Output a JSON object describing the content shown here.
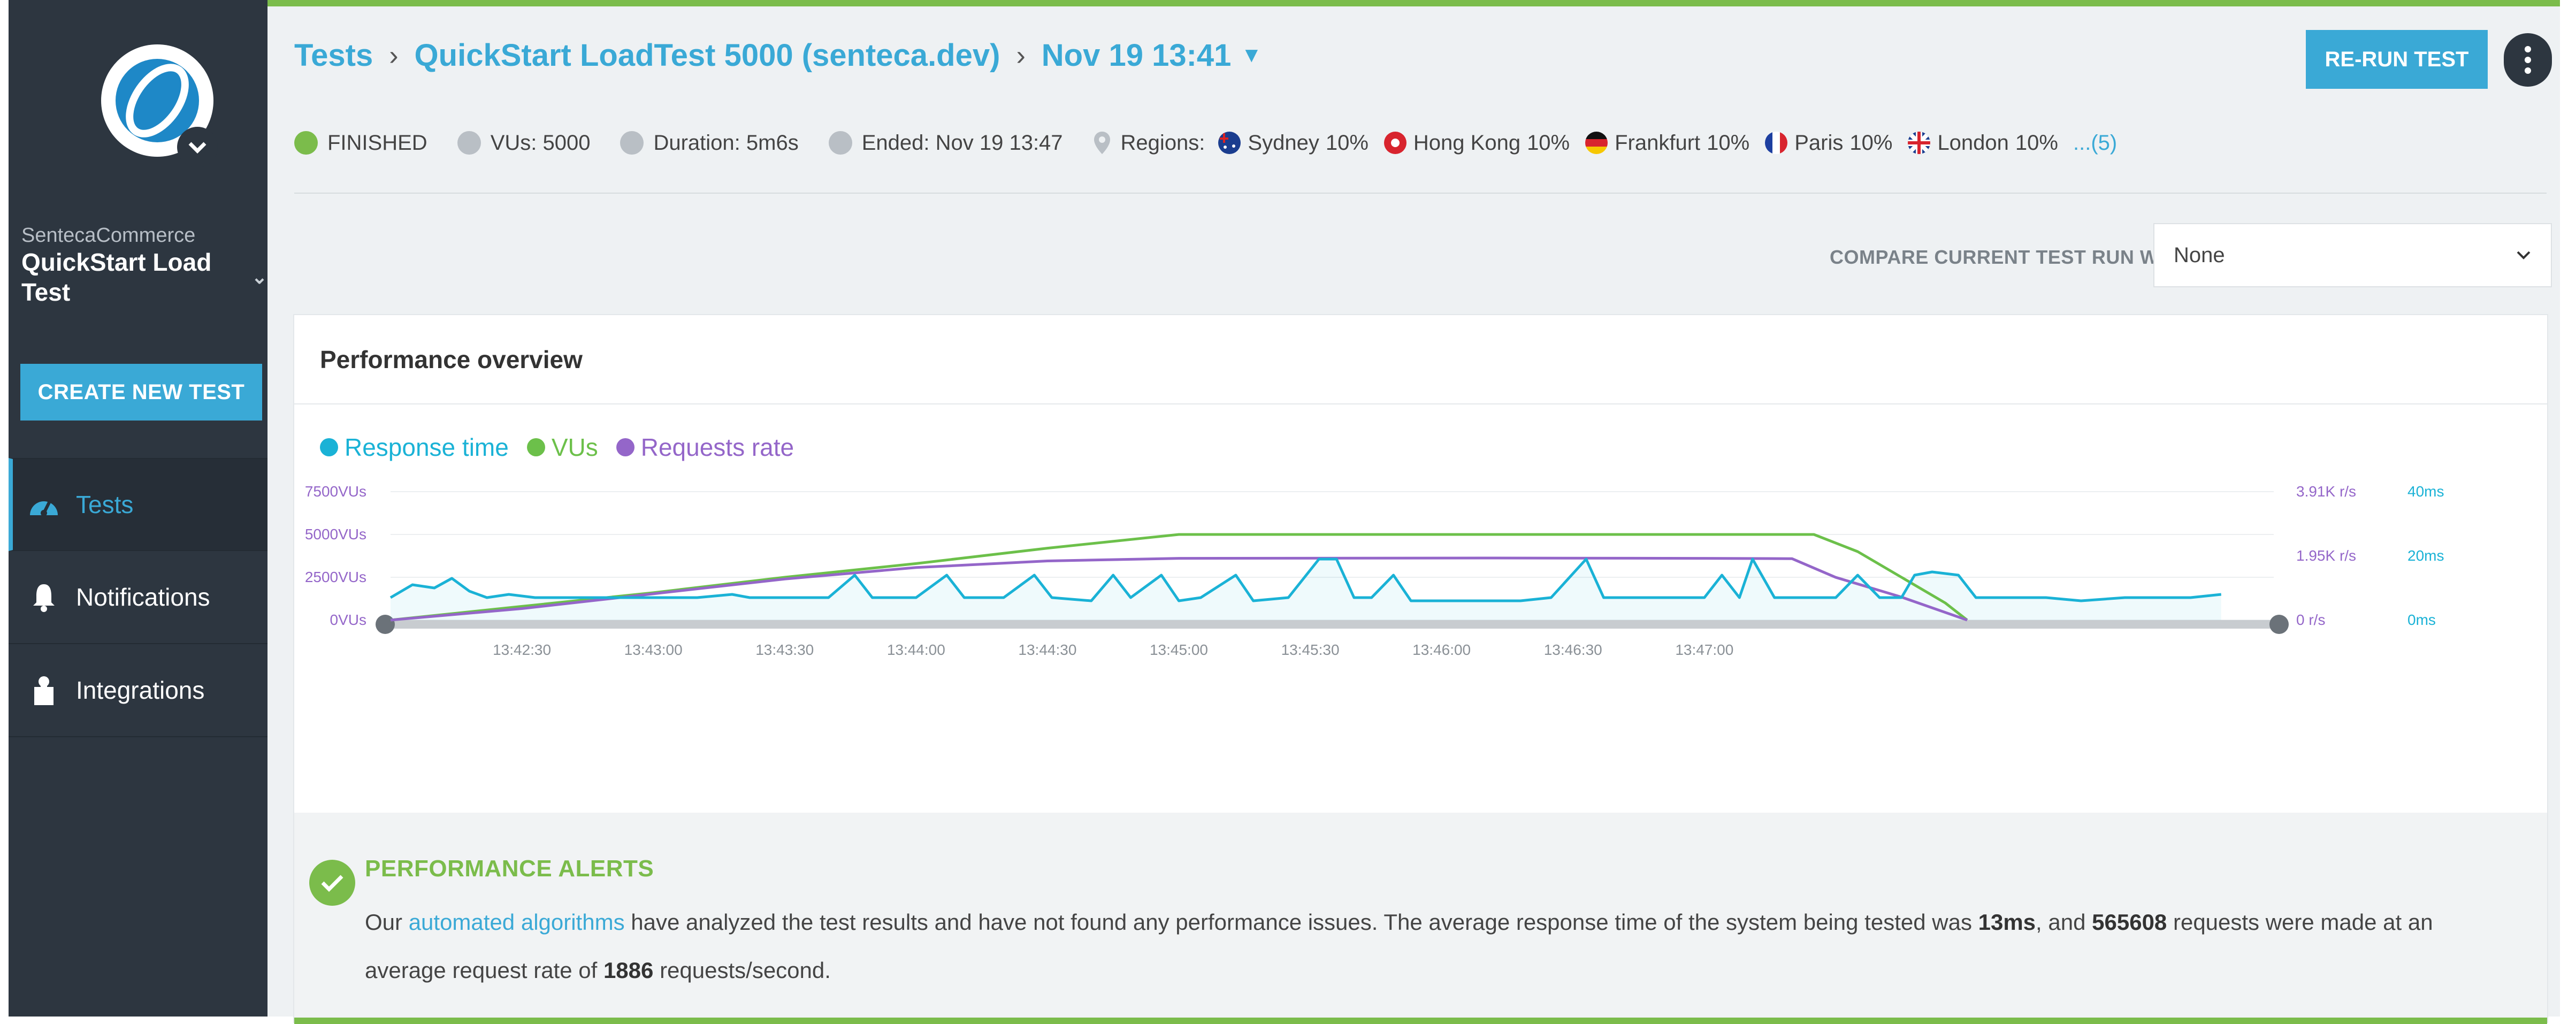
{
  "sidebar": {
    "org_name": "SentecaCommerce",
    "project_name": "QuickStart Load Test",
    "create_button": "CREATE NEW TEST",
    "nav": [
      {
        "label": "Tests",
        "icon": "gauge-icon",
        "active": true
      },
      {
        "label": "Notifications",
        "icon": "bell-icon",
        "active": false
      },
      {
        "label": "Integrations",
        "icon": "puzzle-icon",
        "active": false
      }
    ]
  },
  "header": {
    "breadcrumb": [
      "Tests",
      "QuickStart LoadTest 5000 (senteca.dev)",
      "Nov 19 13:41"
    ],
    "rerun_button": "RE-RUN TEST"
  },
  "status": {
    "state": "FINISHED",
    "vus": "VUs: 5000",
    "duration": "Duration: 5m6s",
    "ended": "Ended: Nov 19 13:47",
    "regions_label": "Regions:",
    "regions": [
      {
        "name": "Sydney",
        "pct": "10%"
      },
      {
        "name": "Hong Kong",
        "pct": "10%"
      },
      {
        "name": "Frankfurt",
        "pct": "10%"
      },
      {
        "name": "Paris",
        "pct": "10%"
      },
      {
        "name": "London",
        "pct": "10%"
      }
    ],
    "more_regions": "...(5)"
  },
  "compare": {
    "label": "COMPARE CURRENT TEST RUN WITH:",
    "selected": "None"
  },
  "overview": {
    "title": "Performance overview"
  },
  "colors": {
    "response": "#1ab2d6",
    "vus": "#6cc04a",
    "requests": "#9466c9",
    "accent": "#3aa9d6"
  },
  "chart_data": {
    "type": "line",
    "legend": [
      "Response time",
      "VUs",
      "Requests rate"
    ],
    "x_ticks": [
      "13:42:30",
      "13:43:00",
      "13:43:30",
      "13:44:00",
      "13:44:30",
      "13:45:00",
      "13:45:30",
      "13:46:00",
      "13:46:30",
      "13:47:00"
    ],
    "y_left_ticks": [
      "7500VUs",
      "5000VUs",
      "2500VUs",
      "0VUs"
    ],
    "y_right1_ticks": [
      "3.91K r/s",
      "1.95K r/s",
      "0 r/s"
    ],
    "y_right2_ticks": [
      "40ms",
      "20ms",
      "0ms"
    ],
    "series": [
      {
        "name": "VUs",
        "points": [
          [
            0,
            0
          ],
          [
            30,
            800
          ],
          [
            60,
            1600
          ],
          [
            90,
            2500
          ],
          [
            120,
            3300
          ],
          [
            150,
            4200
          ],
          [
            180,
            5000
          ],
          [
            250,
            5000
          ],
          [
            300,
            5000
          ],
          [
            325,
            5000
          ],
          [
            335,
            4000
          ],
          [
            345,
            2500
          ],
          [
            355,
            1000
          ],
          [
            360,
            0
          ]
        ]
      },
      {
        "name": "Requests rate",
        "points": [
          [
            0,
            0
          ],
          [
            30,
            350
          ],
          [
            60,
            800
          ],
          [
            90,
            1250
          ],
          [
            120,
            1600
          ],
          [
            150,
            1800
          ],
          [
            180,
            1880
          ],
          [
            250,
            1890
          ],
          [
            300,
            1880
          ],
          [
            320,
            1870
          ],
          [
            330,
            1300
          ],
          [
            345,
            700
          ],
          [
            360,
            0
          ]
        ]
      },
      {
        "name": "Response time",
        "points": [
          [
            0,
            7
          ],
          [
            5,
            11
          ],
          [
            10,
            10
          ],
          [
            14,
            13
          ],
          [
            18,
            9
          ],
          [
            22,
            7
          ],
          [
            27,
            8
          ],
          [
            33,
            7
          ],
          [
            40,
            7
          ],
          [
            50,
            7
          ],
          [
            60,
            7
          ],
          [
            70,
            7
          ],
          [
            78,
            8
          ],
          [
            82,
            7
          ],
          [
            90,
            7
          ],
          [
            100,
            7
          ],
          [
            106,
            14
          ],
          [
            110,
            7
          ],
          [
            120,
            7
          ],
          [
            127,
            14
          ],
          [
            131,
            7
          ],
          [
            140,
            7
          ],
          [
            147,
            14
          ],
          [
            151,
            7
          ],
          [
            160,
            6
          ],
          [
            165,
            14
          ],
          [
            169,
            7
          ],
          [
            176,
            14
          ],
          [
            180,
            6
          ],
          [
            185,
            7
          ],
          [
            193,
            14
          ],
          [
            197,
            6
          ],
          [
            205,
            7
          ],
          [
            212,
            19
          ],
          [
            216,
            19
          ],
          [
            220,
            7
          ],
          [
            224,
            7
          ],
          [
            229,
            14
          ],
          [
            233,
            6
          ],
          [
            245,
            6
          ],
          [
            258,
            6
          ],
          [
            265,
            7
          ],
          [
            273,
            19
          ],
          [
            277,
            7
          ],
          [
            284,
            7
          ],
          [
            290,
            7
          ],
          [
            300,
            7
          ],
          [
            304,
            14
          ],
          [
            308,
            7
          ],
          [
            311,
            19
          ],
          [
            316,
            7
          ],
          [
            322,
            7
          ],
          [
            330,
            7
          ],
          [
            335,
            14
          ],
          [
            340,
            7
          ],
          [
            345,
            7
          ],
          [
            348,
            14
          ],
          [
            352,
            15
          ],
          [
            358,
            14
          ],
          [
            362,
            7
          ],
          [
            372,
            7
          ],
          [
            378,
            7
          ],
          [
            386,
            6
          ],
          [
            396,
            7
          ],
          [
            405,
            7
          ],
          [
            411,
            7
          ],
          [
            418,
            8
          ]
        ]
      }
    ]
  },
  "alerts": {
    "title": "PERFORMANCE ALERTS",
    "text_1": "Our",
    "link": "automated algorithms",
    "text_2": "have analyzed the test results and have not found any performance issues. The average response time of the system being tested was",
    "avg_response": "13ms",
    "text_3": ", and",
    "requests": "565608",
    "text_4": "requests were made at an average request rate of",
    "rate": "1886",
    "text_5": "requests/second."
  }
}
